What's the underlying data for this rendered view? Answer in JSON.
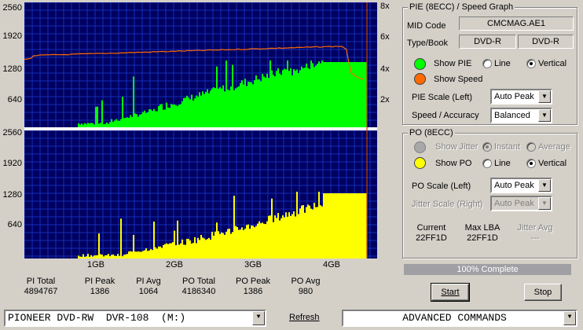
{
  "graph": {
    "pie_y_labels": [
      "2560",
      "1920",
      "1280",
      "640"
    ],
    "speed_labels": [
      "8x",
      "6x",
      "4x",
      "2x"
    ],
    "po_y_labels": [
      "2560",
      "1920",
      "1280",
      "640"
    ],
    "x_labels": [
      "1GB",
      "2GB",
      "3GB",
      "4GB"
    ]
  },
  "stats": [
    {
      "label": "PI Total",
      "value": "4894767"
    },
    {
      "label": "PI Peak",
      "value": "1386"
    },
    {
      "label": "PI Avg",
      "value": "1064"
    },
    {
      "label": "PO Total",
      "value": "4186340"
    },
    {
      "label": "PO Peak",
      "value": "1386"
    },
    {
      "label": "PO Avg",
      "value": "980"
    }
  ],
  "pie_panel": {
    "title": "PIE (8ECC) / Speed Graph",
    "mid_code_label": "MID Code",
    "mid_code_value": "CMCMAG.AE1",
    "type_book_label": "Type/Book",
    "type_value": "DVD-R",
    "book_value": "DVD-R",
    "show_pie_label": "Show PIE",
    "show_speed_label": "Show Speed",
    "line_label": "Line",
    "vertical_label": "Vertical",
    "pie_scale_label": "PIE Scale (Left)",
    "pie_scale_value": "Auto Peak",
    "speed_accuracy_label": "Speed / Accuracy",
    "speed_accuracy_value": "Balanced"
  },
  "po_panel": {
    "title": "PO (8ECC)",
    "show_jitter_label": "Show Jitter",
    "instant_label": "Instant",
    "average_label": "Average",
    "show_po_label": "Show PO",
    "line_label": "Line",
    "vertical_label": "Vertical",
    "po_scale_label": "PO Scale (Left)",
    "po_scale_value": "Auto Peak",
    "jitter_scale_label": "Jitter Scale (Right)",
    "jitter_scale_value": "Auto Peak",
    "current_label": "Current",
    "current_value": "22FF1D",
    "max_lba_label": "Max LBA",
    "max_lba_value": "22FF1D",
    "jitter_avg_label": "Jitter Avg",
    "jitter_avg_value": "---"
  },
  "progress": {
    "text": "100% Complete",
    "fraction": 1.0
  },
  "buttons": {
    "start": "Start",
    "stop": "Stop"
  },
  "bottom": {
    "drive": "PIONEER DVD-RW  DVR-108  (M:)",
    "refresh": "Refresh",
    "commands": "ADVANCED COMMANDS"
  },
  "colors": {
    "graph_bg": "#000060",
    "grid": "#1a3ad0",
    "pie": "#00ff00",
    "po": "#ffff00",
    "speed": "#ff6a00",
    "marker": "#c04000"
  }
}
